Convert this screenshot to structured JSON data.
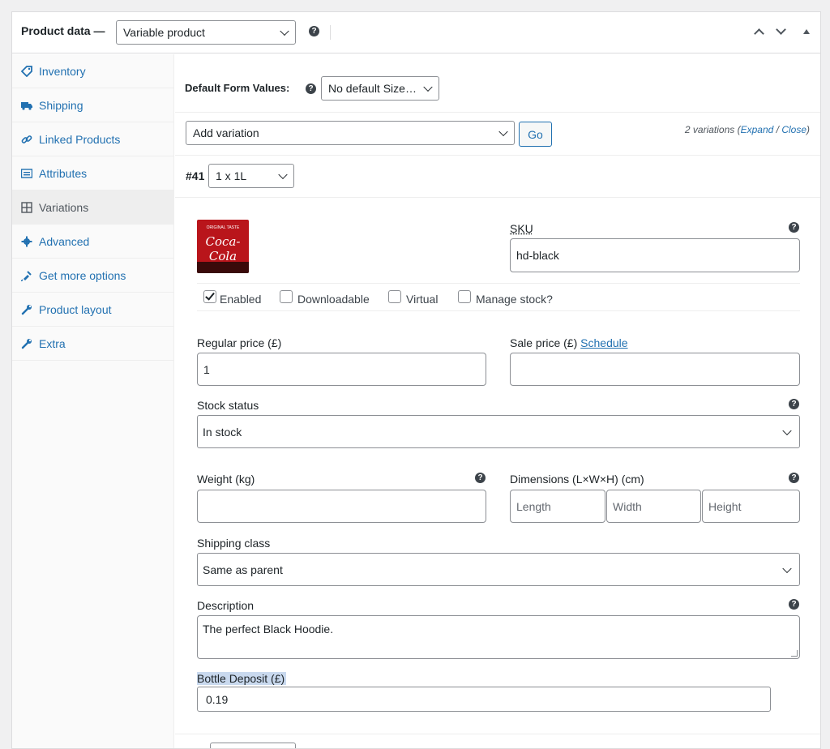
{
  "header": {
    "title": "Product data —",
    "product_type": "Variable product",
    "help": "?"
  },
  "sidebar": {
    "items": [
      {
        "label": "Inventory",
        "icon": "tag-icon"
      },
      {
        "label": "Shipping",
        "icon": "truck-icon"
      },
      {
        "label": "Linked Products",
        "icon": "link-icon"
      },
      {
        "label": "Attributes",
        "icon": "list-icon"
      },
      {
        "label": "Variations",
        "icon": "grid-icon"
      },
      {
        "label": "Advanced",
        "icon": "gear-icon"
      },
      {
        "label": "Get more options",
        "icon": "plug-icon"
      },
      {
        "label": "Product layout",
        "icon": "wrench-icon"
      },
      {
        "label": "Extra",
        "icon": "wrench-icon"
      }
    ],
    "active": "Variations"
  },
  "defaults": {
    "label": "Default Form Values:",
    "size_value": "No default Size…"
  },
  "variation_bar": {
    "action": "Add variation",
    "go_label": "Go",
    "count_text": "2 variations (",
    "expand": "Expand",
    "slash": " / ",
    "close": "Close",
    "close_paren": ")"
  },
  "variation": {
    "id": "#41",
    "attribute_value": "1 x 1L",
    "image_text": "Coca-Cola",
    "image_small": "ORIGINAL TASTE",
    "sku_label": "SKU",
    "sku_value": "hd-black",
    "checkboxes": [
      {
        "label": "Enabled",
        "checked": true
      },
      {
        "label": "Downloadable",
        "checked": false
      },
      {
        "label": "Virtual",
        "checked": false
      },
      {
        "label": "Manage stock?",
        "checked": false
      }
    ],
    "regular_price_label": "Regular price (£)",
    "regular_price_value": "1",
    "sale_price_label": "Sale price (£)",
    "schedule_label": "Schedule",
    "sale_price_value": "",
    "stock_status_label": "Stock status",
    "stock_status_value": "In stock",
    "weight_label": "Weight (kg)",
    "weight_value": "",
    "dimensions_label": "Dimensions (L×W×H) (cm)",
    "length_placeholder": "Length",
    "width_placeholder": "Width",
    "height_placeholder": "Height",
    "shipping_class_label": "Shipping class",
    "shipping_class_value": "Same as parent",
    "description_label": "Description",
    "description_value": "The perfect Black Hoodie.",
    "deposit_label": "Bottle Deposit (£)",
    "deposit_value": "0.19"
  }
}
